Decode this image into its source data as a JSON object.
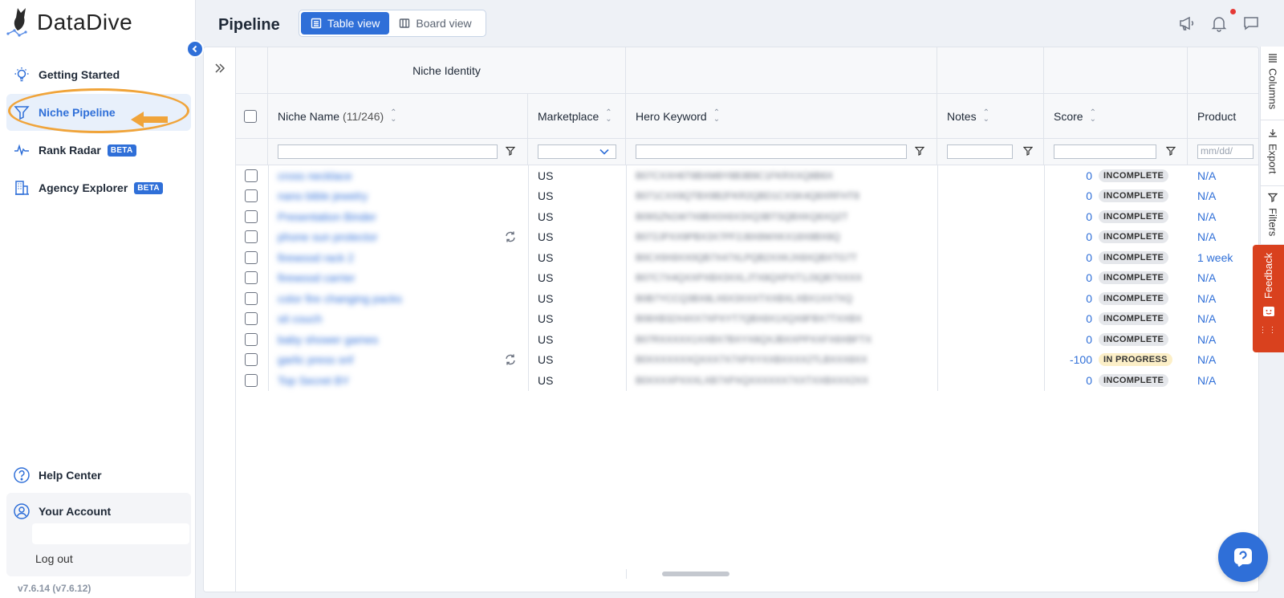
{
  "app": {
    "name": "DataDive",
    "version": "v7.6.14 (v7.6.12)"
  },
  "sidebar": {
    "items": [
      {
        "label": "Getting Started",
        "icon": "lightbulb-icon"
      },
      {
        "label": "Niche Pipeline",
        "icon": "funnel-icon",
        "active": true
      },
      {
        "label": "Rank Radar",
        "icon": "activity-icon",
        "badge": "BETA"
      },
      {
        "label": "Agency Explorer",
        "icon": "building-icon",
        "badge": "BETA"
      }
    ],
    "help": "Help Center",
    "account": "Your Account",
    "logout": "Log out"
  },
  "header": {
    "title": "Pipeline",
    "table_view": "Table view",
    "board_view": "Board view"
  },
  "grid": {
    "group_label": "Niche Identity",
    "columns": {
      "niche_name": "Niche Name",
      "niche_count": "(11/246)",
      "marketplace": "Marketplace",
      "hero_keyword": "Hero Keyword",
      "notes": "Notes",
      "score": "Score",
      "product": "Product"
    },
    "date_placeholder": "mm/dd/",
    "rows": [
      {
        "niche": "cross necklace",
        "marketplace": "US",
        "hero": "B07CXXH6T8BXM8Y8B3B9C1FKRXXQ8B6X",
        "score": "0",
        "status": "INCOMPLETE",
        "product": "N/A",
        "refresh": false
      },
      {
        "niche": "nano bible jewelry",
        "marketplace": "US",
        "hero": "B071CXX9QTBX9B2FKR2QBD1CXSK4Q8XRFHT8",
        "score": "0",
        "status": "INCOMPLETE",
        "product": "N/A",
        "refresh": false
      },
      {
        "niche": "Presentation Binder",
        "marketplace": "US",
        "hero": "B09SZN1W7X8BX0X6X3XQ3BTSQBXKQ6XQ2T",
        "score": "0",
        "status": "INCOMPLETE",
        "product": "N/A",
        "refresh": false
      },
      {
        "niche": "phone sun protector",
        "marketplace": "US",
        "hero": "B072JPXX9PBX3X7PF2J8X8WXKX18X8BX8Q",
        "score": "0",
        "status": "INCOMPLETE",
        "product": "N/A",
        "refresh": true
      },
      {
        "niche": "firewood rack 2",
        "marketplace": "US",
        "hero": "B0CX9X8XX0QB7X47XLPQB2XXKJX8XQBXTG7T",
        "score": "0",
        "status": "INCOMPLETE",
        "product": "1 week",
        "refresh": false
      },
      {
        "niche": "firewood carrier",
        "marketplace": "US",
        "hero": "B07C7X4QXXPXBX3XXLJTX8QXPXT1J3QB7XXXX",
        "score": "0",
        "status": "INCOMPLETE",
        "product": "N/A",
        "refresh": false
      },
      {
        "niche": "color fire changing packs",
        "marketplace": "US",
        "hero": "B0B7YCCQ3BX8LX6X3XXXTXXBXLXBX1XX7XQ",
        "score": "0",
        "status": "INCOMPLETE",
        "product": "N/A",
        "refresh": false
      },
      {
        "niche": "sit couch",
        "marketplace": "US",
        "hero": "B08XB32X4XX7XPXYT7QBX8X1XQX8FBX7TXXBX",
        "score": "0",
        "status": "INCOMPLETE",
        "product": "N/A",
        "refresh": false
      },
      {
        "niche": "baby shower games",
        "marketplace": "US",
        "hero": "B07RXXXXX1XXBX7BXYX8QXJBXXPPXXFX8XBFTX",
        "score": "0",
        "status": "INCOMPLETE",
        "product": "N/A",
        "refresh": false
      },
      {
        "niche": "garlic press snf",
        "marketplace": "US",
        "hero": "B0XXXXXXXQXXX7X7XPXYXXBXXXX2TLBXXX8XX",
        "score": "-100",
        "status": "IN PROGRESS",
        "product": "N/A",
        "refresh": true
      },
      {
        "niche": "Top Secret BY",
        "marketplace": "US",
        "hero": "B0XXXXPXXXLXB7XPXQXXXXXX7XXTXXBXXX2XX",
        "score": "0",
        "status": "INCOMPLETE",
        "product": "N/A",
        "refresh": false
      }
    ]
  },
  "side_panel": {
    "columns": "Columns",
    "export": "Export",
    "filters": "Filters"
  },
  "feedback": "Feedback"
}
